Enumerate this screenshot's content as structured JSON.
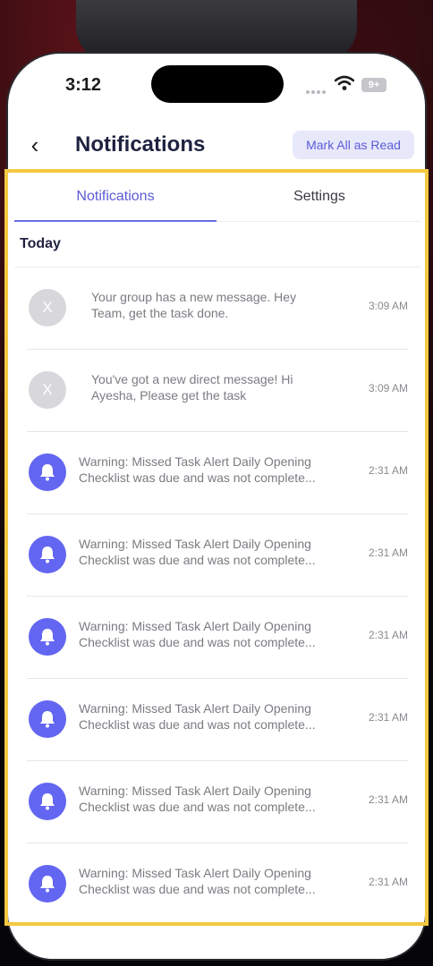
{
  "status_bar": {
    "time": "3:12",
    "battery": "9+"
  },
  "header": {
    "title": "Notifications",
    "mark_all_read_label": "Mark All as Read"
  },
  "tabs": [
    {
      "label": "Notifications",
      "active": true
    },
    {
      "label": "Settings",
      "active": false
    }
  ],
  "section": {
    "title": "Today"
  },
  "notifications": [
    {
      "avatar": "X",
      "icon": "user-initial-avatar",
      "line1": "Your group has a new message. Hey",
      "line2": "Team, get the task done.",
      "time": "3:09 AM"
    },
    {
      "avatar": "X",
      "icon": "user-initial-avatar",
      "line1": "You've got a new direct message! Hi",
      "line2": "Ayesha, Please get the task",
      "time": "3:09 AM"
    },
    {
      "icon": "bell-icon",
      "line1": "Warning: Missed Task Alert Daily Opening",
      "line2": "Checklist  was due and was not complete...",
      "time": "2:31 AM"
    },
    {
      "icon": "bell-icon",
      "line1": "Warning: Missed Task Alert Daily Opening",
      "line2": "Checklist  was due and was not complete...",
      "time": "2:31 AM"
    },
    {
      "icon": "bell-icon",
      "line1": "Warning: Missed Task Alert Daily Opening",
      "line2": "Checklist  was due and was not complete...",
      "time": "2:31 AM"
    },
    {
      "icon": "bell-icon",
      "line1": "Warning: Missed Task Alert Daily Opening",
      "line2": "Checklist  was due and was not complete...",
      "time": "2:31 AM"
    },
    {
      "icon": "bell-icon",
      "line1": "Warning: Missed Task Alert Daily Opening",
      "line2": "Checklist  was due and was not complete...",
      "time": "2:31 AM"
    },
    {
      "icon": "bell-icon",
      "line1": "Warning: Missed Task Alert Daily Opening",
      "line2": "Checklist  was due and was not complete...",
      "time": "2:31 AM"
    }
  ],
  "colors": {
    "accent": "#5a5cd6",
    "bell_avatar": "#6366f1",
    "highlight_frame": "#f5c842",
    "button_bg": "#e8e8fb"
  }
}
